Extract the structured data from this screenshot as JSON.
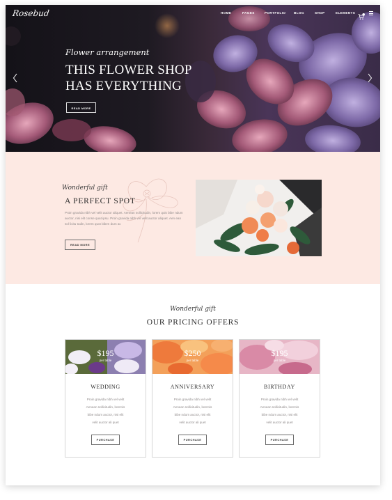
{
  "site": {
    "logo": "Rosebud"
  },
  "nav": {
    "items": [
      "HOME",
      "PAGES",
      "PORTFOLIO",
      "BLOG",
      "SHOP",
      "ELEMENTS"
    ],
    "cart_count": "0"
  },
  "hero": {
    "script": "Flower arrangement",
    "title_line1": "THIS FLOWER SHOP",
    "title_line2": "HAS EVERYTHING",
    "button": "READ MORE"
  },
  "spot": {
    "script": "Wonderful gift",
    "title": "A PERFECT SPOT",
    "text": "Proin gravida nibh vel velit auctor aliquet. Aenean sollicitudin, lorem quis bibe ndum auctor, nisi elit conse quat ipsu. Proin gravida nibh vel velit auctor aliquet. Aen ean sol licitu tudin, lorem quot biben dum ac",
    "button": "READ MORE"
  },
  "pricing": {
    "script": "Wonderful gift",
    "title": "OUR PRICING OFFERS",
    "cards": [
      {
        "price": "$195",
        "per": "per table",
        "name": "WEDDING",
        "features": [
          "Proin gravida nibh vel velit",
          "Aenean sollicitudin, loremis",
          "bibe ndum auctor, nisi elit",
          "velit auctor ali quet"
        ],
        "button": "PURCHASE"
      },
      {
        "price": "$250",
        "per": "per table",
        "name": "ANNIVERSARY",
        "features": [
          "Proin gravida nibh vel velit",
          "Aenean sollicitudin, loremis",
          "bibe ndum auctor, nisi elit",
          "velit auctor ali quet"
        ],
        "button": "PURCHASE"
      },
      {
        "price": "$195",
        "per": "per table",
        "name": "BIRTHDAY",
        "features": [
          "Proin gravida nibh vel velit",
          "Aenean sollicitudin, loremis",
          "bibe ndum auctor, nisi elit",
          "velit auctor ali quet"
        ],
        "button": "PURCHASE"
      }
    ]
  },
  "colors": {
    "hero_dark": "#141218",
    "petal_purple": "#8a78b8",
    "petal_pink": "#c27a93",
    "spot_bg": "#fde9e3",
    "border": "#d6d6d6"
  },
  "icons": [
    "left-arrow-icon",
    "right-arrow-icon",
    "cart-icon",
    "hamburger-menu-icon"
  ]
}
